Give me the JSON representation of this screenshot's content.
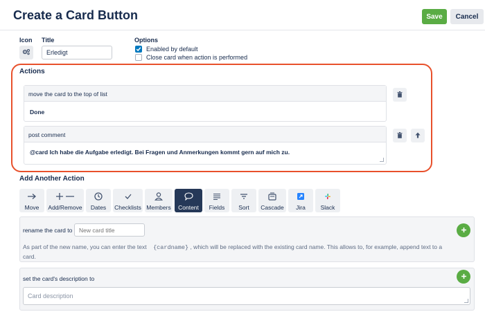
{
  "header": {
    "title": "Create a Card Button",
    "save_label": "Save",
    "cancel_label": "Cancel"
  },
  "form": {
    "icon_label": "Icon",
    "title_label": "Title",
    "title_value": "Erledigt",
    "options_label": "Options",
    "options": [
      {
        "label": "Enabled by default",
        "checked": true
      },
      {
        "label": "Close card when action is performed",
        "checked": false
      }
    ]
  },
  "actions": {
    "title": "Actions",
    "items": [
      {
        "head": "move the card to the top of list",
        "value": "Done"
      },
      {
        "head": "post comment",
        "value": "@card Ich habe die Aufgabe erledigt. Bei Fragen und Anmerkungen kommt gern auf mich zu."
      }
    ]
  },
  "add_action": {
    "title": "Add Another Action",
    "types": [
      {
        "label": "Move",
        "icon": "arrow-right-icon"
      },
      {
        "label": "Add/Remove",
        "icon": "plus-minus-icon"
      },
      {
        "label": "Dates",
        "icon": "clock-icon"
      },
      {
        "label": "Checklists",
        "icon": "checkmark-icon"
      },
      {
        "label": "Members",
        "icon": "person-icon"
      },
      {
        "label": "Content",
        "icon": "speech-bubble-icon",
        "active": true
      },
      {
        "label": "Fields",
        "icon": "lines-icon"
      },
      {
        "label": "Sort",
        "icon": "sort-icon"
      },
      {
        "label": "Cascade",
        "icon": "cascade-icon"
      },
      {
        "label": "Jira",
        "icon": "jira-icon"
      },
      {
        "label": "Slack",
        "icon": "slack-icon"
      }
    ]
  },
  "content_panels": {
    "rename": {
      "label": "rename the card to",
      "placeholder": "New card title",
      "help_before": "As part of the new name, you can enter the text",
      "help_code": "{cardname}",
      "help_after": ", which will be replaced with the existing card name. This allows to, for example, append text to a",
      "help_line2": "card."
    },
    "description": {
      "label": "set the card's description to",
      "placeholder": "Card description"
    }
  },
  "colors": {
    "accent_green": "#5aac44",
    "highlight": "#e8502b",
    "checkbox_blue": "#0079bf",
    "active_dark": "#253858"
  }
}
